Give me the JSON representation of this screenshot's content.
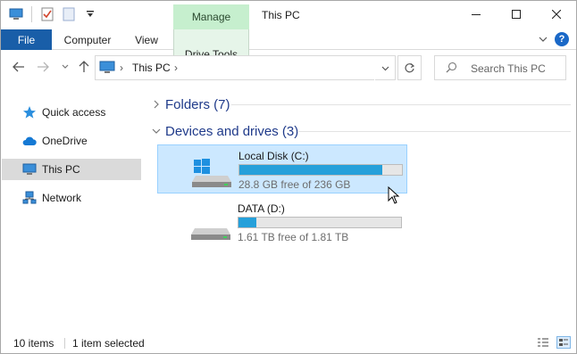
{
  "window": {
    "title": "This PC",
    "contextual_tab": "Manage"
  },
  "ribbon": {
    "tabs": [
      "File",
      "Computer",
      "View",
      "Drive Tools"
    ]
  },
  "address_bar": {
    "crumbs": [
      "This PC"
    ],
    "search_placeholder": "Search This PC"
  },
  "nav_pane": {
    "items": [
      {
        "label": "Quick access",
        "icon": "star-icon"
      },
      {
        "label": "OneDrive",
        "icon": "cloud-icon"
      },
      {
        "label": "This PC",
        "icon": "computer-icon",
        "selected": true
      },
      {
        "label": "Network",
        "icon": "network-icon"
      }
    ]
  },
  "content": {
    "groups": [
      {
        "title": "Folders (7)",
        "expanded": false
      },
      {
        "title": "Devices and drives (3)",
        "expanded": true
      }
    ],
    "drives": [
      {
        "name": "Local Disk (C:)",
        "free_text": "28.8 GB free of 236 GB",
        "used_fraction": 0.878,
        "selected": true
      },
      {
        "name": "DATA (D:)",
        "free_text": "1.61 TB free of 1.81 TB",
        "used_fraction": 0.11,
        "selected": false
      }
    ]
  },
  "status_bar": {
    "items_count": "10 items",
    "selection": "1 item selected"
  },
  "colors": {
    "accent": "#26a0da",
    "selection_bg": "#cce8ff",
    "manage_tab_bg": "#c6efce",
    "file_tab_bg": "#195ea8",
    "group_title": "#1f3a8a"
  }
}
